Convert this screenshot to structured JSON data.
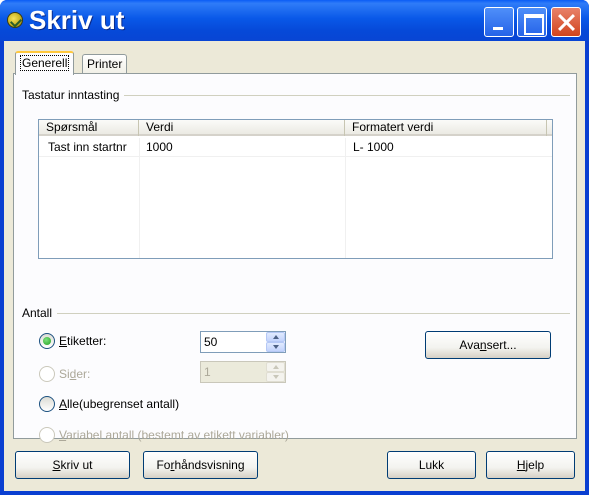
{
  "window": {
    "title": "Skriv ut"
  },
  "tabs": [
    {
      "label": "Generell",
      "active": true
    },
    {
      "label": "Printer",
      "active": false
    }
  ],
  "keyboard_input": {
    "group_label": "Tastatur inntasting",
    "columns": [
      "Spørsmål",
      "Verdi",
      "Formatert verdi"
    ],
    "rows": [
      {
        "question": "Tast inn startnr",
        "value": "1000",
        "formatted": "L- 1000"
      }
    ]
  },
  "quantity": {
    "group_label": "Antall",
    "labels_option": {
      "pre": "",
      "mnemonic": "E",
      "post": "tiketter:",
      "checked": true,
      "enabled": true,
      "value": "50"
    },
    "pages_option": {
      "pre": "Si",
      "mnemonic": "d",
      "post": "er:",
      "checked": false,
      "enabled": false,
      "value": "1"
    },
    "all_option": {
      "pre": "",
      "mnemonic": "A",
      "post": "lle(ubegrenset antall)",
      "checked": false,
      "enabled": true
    },
    "variable_option": {
      "pre": "",
      "mnemonic": "V",
      "post": "ariabel antall (bestemt av etikett variabler)",
      "checked": false,
      "enabled": false
    },
    "advanced_button": {
      "pre": "Ava",
      "mnemonic": "n",
      "post": "sert..."
    }
  },
  "buttons": {
    "print": {
      "pre": "",
      "mnemonic": "S",
      "post": "kriv ut"
    },
    "preview": {
      "pre": "Fo",
      "mnemonic": "r",
      "post": "håndsvisning"
    },
    "close": {
      "pre": "Lukk",
      "mnemonic": "",
      "post": ""
    },
    "help": {
      "pre": "",
      "mnemonic": "H",
      "post": "jelp"
    }
  }
}
